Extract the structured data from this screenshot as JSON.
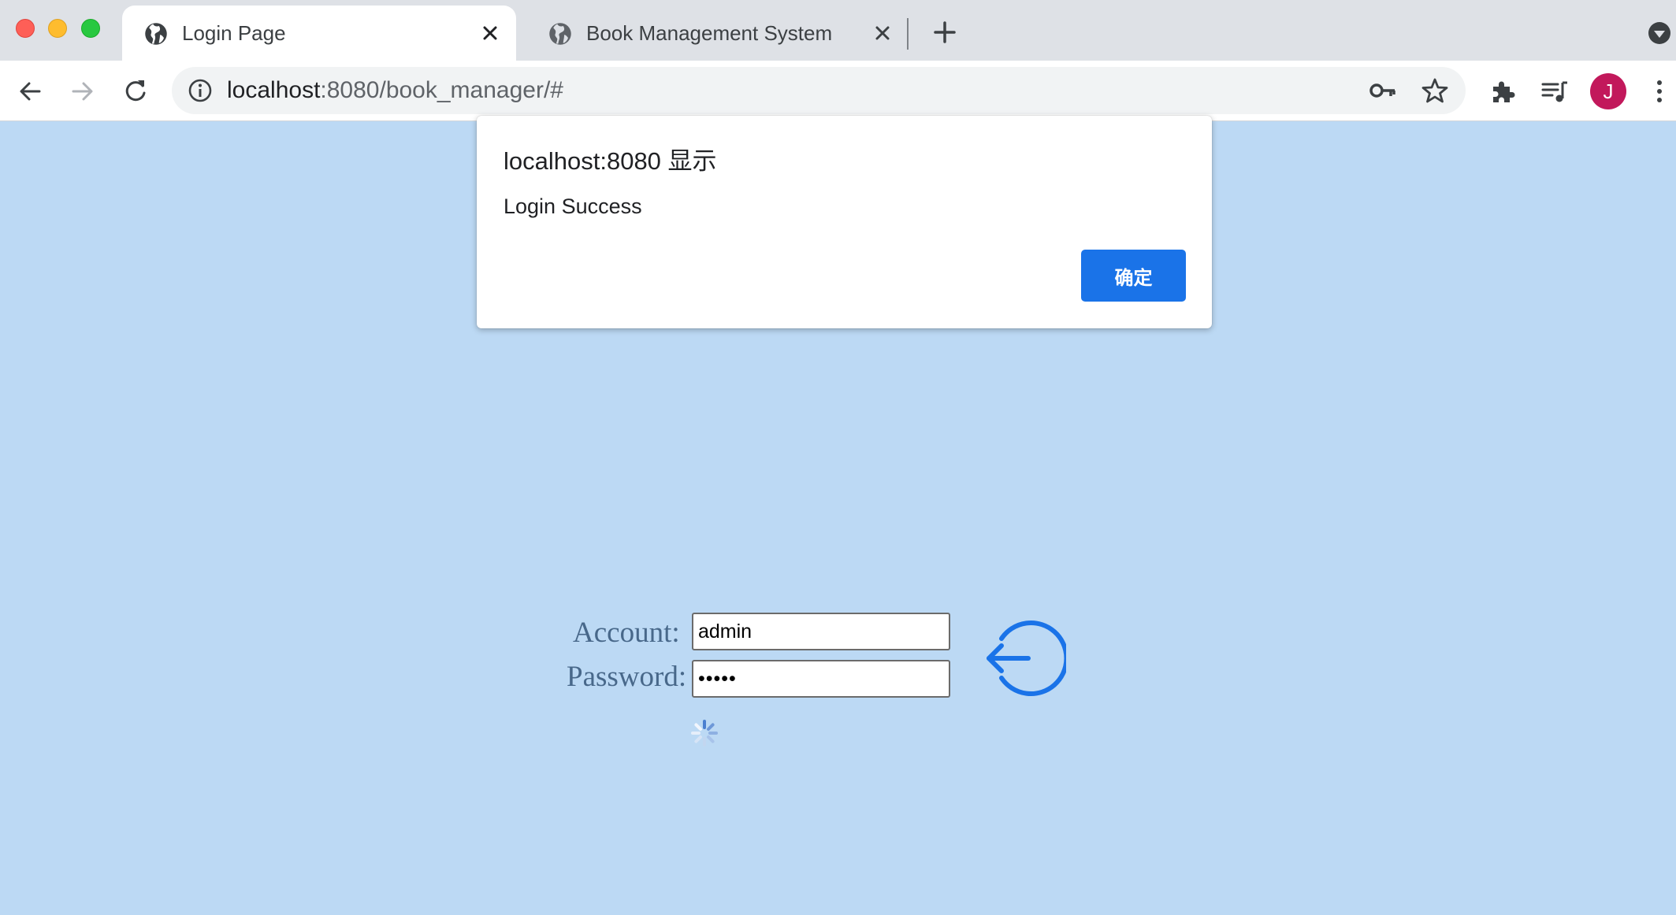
{
  "browser": {
    "tabs": [
      {
        "title": "Login Page",
        "active": true
      },
      {
        "title": "Book Management System",
        "active": false
      }
    ],
    "url": {
      "host": "localhost",
      "rest": ":8080/book_manager/#"
    },
    "profile_initial": "J",
    "colors": {
      "accent": "#1a73e8",
      "avatar": "#c2185b",
      "page_bg": "#bcd9f4"
    }
  },
  "dialog": {
    "title": "localhost:8080 显示",
    "message": "Login Success",
    "ok_label": "确定"
  },
  "login": {
    "account_label": "Account:",
    "account_value": "admin",
    "password_label": "Password:",
    "password_value": "•••••"
  },
  "icons": [
    "globe-icon",
    "close-icon",
    "new-tab-icon",
    "back-icon",
    "forward-icon",
    "reload-icon",
    "info-icon",
    "key-icon",
    "star-icon",
    "extensions-icon",
    "media-icon",
    "menu-icon",
    "login-arrow-icon",
    "loading-spinner-icon"
  ]
}
